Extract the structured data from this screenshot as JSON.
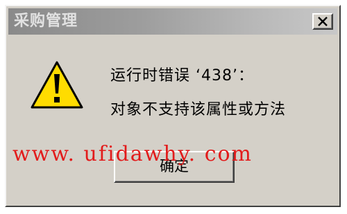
{
  "dialog": {
    "title": "采购管理",
    "close_label": "×",
    "message_line1": "运行时错误 ‘438’：",
    "message_line2": "对象不支持该属性或方法",
    "ok_label": "确定"
  },
  "watermark": {
    "text": "www. ufidawhy. com",
    "color": "#e21b1b"
  },
  "icons": {
    "warning": "warning-triangle-icon",
    "close": "close-icon"
  },
  "colors": {
    "dialog_bg": "#d4d0c8",
    "titlebar_gradient_start": "#8a8a8a",
    "titlebar_gradient_end": "#c8c8c8",
    "warning_yellow": "#ffdc00"
  }
}
